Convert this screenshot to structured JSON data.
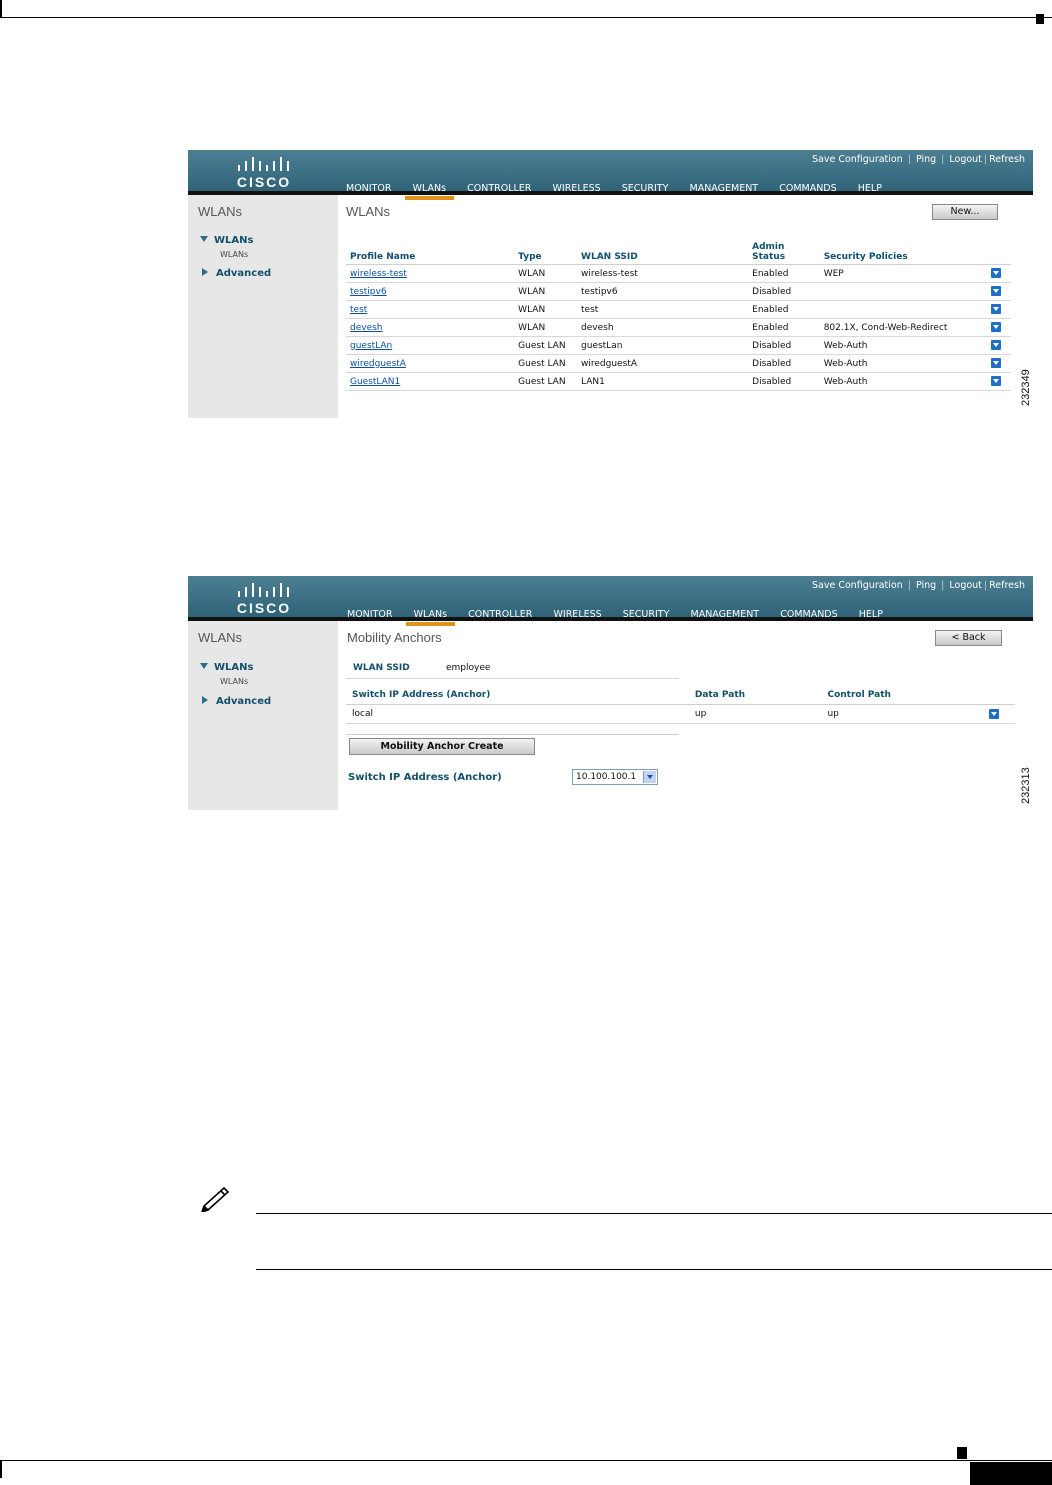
{
  "brand": {
    "logo_text": "CISCO"
  },
  "header": {
    "top_links": [
      "Save Configuration",
      "Ping",
      "Logout",
      "Refresh"
    ],
    "nav": [
      "MONITOR",
      "WLANs",
      "CONTROLLER",
      "WIRELESS",
      "SECURITY",
      "MANAGEMENT",
      "COMMANDS",
      "HELP"
    ],
    "active_nav": "WLANs"
  },
  "sidebar": {
    "title": "WLANs",
    "items": [
      {
        "label": "WLANs",
        "sub": "WLANs",
        "expanded": true
      },
      {
        "label": "Advanced",
        "expanded": false
      }
    ]
  },
  "panel1": {
    "title": "WLANs",
    "new_button": "New...",
    "columns": [
      "Profile Name",
      "Type",
      "WLAN SSID",
      "Admin Status",
      "Security Policies"
    ],
    "rows": [
      {
        "profile": "wireless-test",
        "type": "WLAN",
        "ssid": "wireless-test",
        "status": "Enabled",
        "security": "WEP"
      },
      {
        "profile": "testipv6",
        "type": "WLAN",
        "ssid": "testipv6",
        "status": "Disabled",
        "security": ""
      },
      {
        "profile": "test",
        "type": "WLAN",
        "ssid": "test",
        "status": "Enabled",
        "security": ""
      },
      {
        "profile": "devesh",
        "type": "WLAN",
        "ssid": "devesh",
        "status": "Enabled",
        "security": "802.1X, Cond-Web-Redirect"
      },
      {
        "profile": "guestLAn",
        "type": "Guest LAN",
        "ssid": "guestLan",
        "status": "Disabled",
        "security": "Web-Auth"
      },
      {
        "profile": "wiredguestA",
        "type": "Guest LAN",
        "ssid": "wiredguestA",
        "status": "Disabled",
        "security": "Web-Auth"
      },
      {
        "profile": "GuestLAN1",
        "type": "Guest LAN",
        "ssid": "LAN1",
        "status": "Disabled",
        "security": "Web-Auth"
      }
    ],
    "figure_number": "232349"
  },
  "panel2": {
    "title": "Mobility Anchors",
    "back_button": "< Back",
    "ssid_label": "WLAN SSID",
    "ssid_value": "employee",
    "columns": [
      "Switch IP Address (Anchor)",
      "Data Path",
      "Control Path"
    ],
    "rows": [
      {
        "ip": "local",
        "data_path": "up",
        "control_path": "up"
      }
    ],
    "create_button": "Mobility Anchor Create",
    "anchor_label": "Switch IP Address (Anchor)",
    "anchor_value": "10.100.100.1",
    "figure_number": "232313"
  },
  "colors": {
    "header": "#3a6f84",
    "accent": "#e0931b",
    "label": "#124f6b",
    "link": "#0a4fa0"
  }
}
